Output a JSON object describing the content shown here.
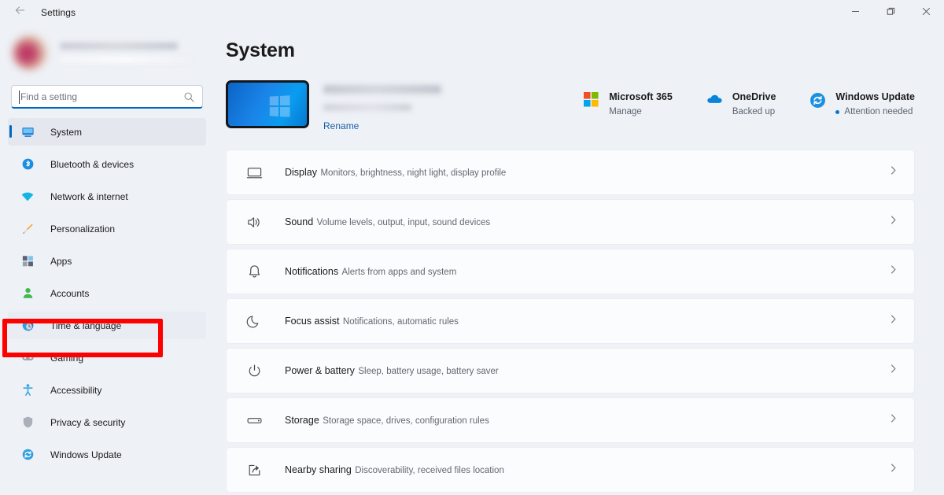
{
  "titlebar": {
    "back_icon": "back-arrow-icon",
    "title": "Settings",
    "minimize_label": "Minimize",
    "maximize_label": "Restore",
    "close_label": "Close"
  },
  "sidebar": {
    "account": {
      "avatar": "user-avatar-blurred",
      "name": "",
      "email": ""
    },
    "search": {
      "placeholder": "Find a setting",
      "value": "",
      "icon": "search-icon"
    },
    "items": [
      {
        "label": "System",
        "icon": "monitor-icon",
        "state": "active"
      },
      {
        "label": "Bluetooth & devices",
        "icon": "bluetooth-icon",
        "state": "normal"
      },
      {
        "label": "Network & internet",
        "icon": "wifi-icon",
        "state": "normal"
      },
      {
        "label": "Personalization",
        "icon": "paintbrush-icon",
        "state": "normal"
      },
      {
        "label": "Apps",
        "icon": "apps-grid-icon",
        "state": "normal"
      },
      {
        "label": "Accounts",
        "icon": "person-icon",
        "state": "normal"
      },
      {
        "label": "Time & language",
        "icon": "clock-globe-icon",
        "state": "hover"
      },
      {
        "label": "Gaming",
        "icon": "gamepad-icon",
        "state": "normal"
      },
      {
        "label": "Accessibility",
        "icon": "accessibility-icon",
        "state": "normal"
      },
      {
        "label": "Privacy & security",
        "icon": "shield-icon",
        "state": "normal"
      },
      {
        "label": "Windows Update",
        "icon": "update-sync-icon",
        "state": "normal"
      }
    ],
    "annotation": {
      "target": "Time & language",
      "color": "#ff0000"
    }
  },
  "main": {
    "page_title": "System",
    "device": {
      "thumbnail": "windows-wallpaper-thumbnail",
      "name": "",
      "model": "",
      "rename_label": "Rename"
    },
    "status_tiles": [
      {
        "title": "Microsoft 365",
        "subtitle": "Manage",
        "icon": "microsoft-logo-icon",
        "has_dot": false
      },
      {
        "title": "OneDrive",
        "subtitle": "Backed up",
        "icon": "onedrive-cloud-icon",
        "has_dot": false
      },
      {
        "title": "Windows Update",
        "subtitle": "Attention needed",
        "icon": "update-sync-icon",
        "has_dot": true
      }
    ],
    "settings_rows": [
      {
        "title": "Display",
        "subtitle": "Monitors, brightness, night light, display profile",
        "icon": "monitor-outline-icon"
      },
      {
        "title": "Sound",
        "subtitle": "Volume levels, output, input, sound devices",
        "icon": "speaker-icon"
      },
      {
        "title": "Notifications",
        "subtitle": "Alerts from apps and system",
        "icon": "bell-icon"
      },
      {
        "title": "Focus assist",
        "subtitle": "Notifications, automatic rules",
        "icon": "moon-icon"
      },
      {
        "title": "Power & battery",
        "subtitle": "Sleep, battery usage, battery saver",
        "icon": "power-icon"
      },
      {
        "title": "Storage",
        "subtitle": "Storage space, drives, configuration rules",
        "icon": "drive-icon"
      },
      {
        "title": "Nearby sharing",
        "subtitle": "Discoverability, received files location",
        "icon": "share-icon"
      }
    ],
    "chevron_icon": "chevron-right-icon"
  },
  "colors": {
    "accent": "#0067c0",
    "page_bg": "#eef1f6",
    "card_bg": "#fbfcfd",
    "annotation": "#ff0000",
    "link": "#1a5fa8"
  }
}
